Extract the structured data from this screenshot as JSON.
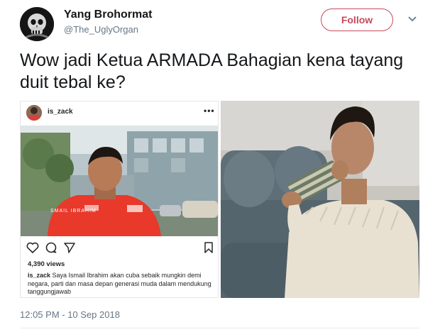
{
  "tweet": {
    "display_name": "Yang Brohormat",
    "handle": "@The_UglyOrgan",
    "follow_label": "Follow",
    "text": "Wow jadi Ketua ARMADA Bahagian kena tayang duit tebal ke?",
    "timestamp": "12:05 PM - 10 Sep 2018"
  },
  "embedded_post": {
    "username": "is_zack",
    "more": "•••",
    "photo_overlay_name": "SMAIL IBRAHIM",
    "views": "4,390 views",
    "caption_user": "is_zack",
    "caption_text": " Saya Ismail Ibrahim akan cuba sebaik mungkin demi negara, parti dan masa depan generasi muda dalam mendukung tanggungjawab",
    "icons": [
      "heart-icon",
      "comment-icon",
      "share-icon",
      "bookmark-icon"
    ]
  },
  "colors": {
    "accent": "#c64a5b",
    "muted": "#657786",
    "shirt": "#e8392b"
  }
}
